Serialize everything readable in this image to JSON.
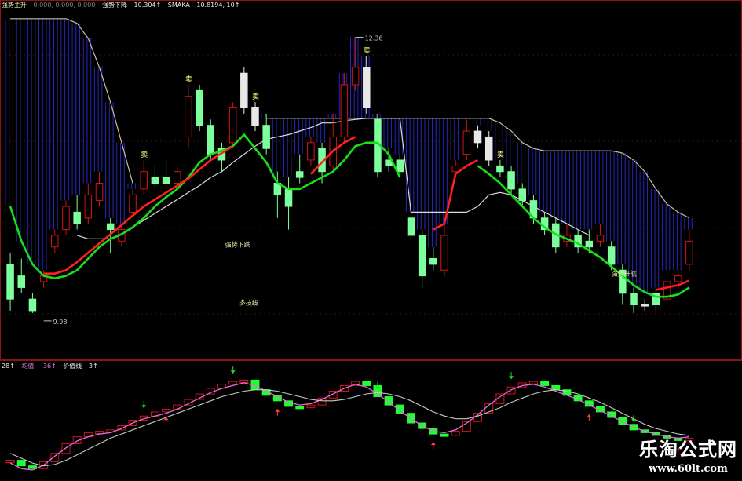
{
  "top_legend": {
    "name1": "强势主升",
    "vals1": "0.000, 0.000, 0.000",
    "name2": "强势下降",
    "val2": "10.304↑",
    "name3": "SMAKA",
    "val3": "10.8194, 10↑"
  },
  "bottom_legend": {
    "v1": "28↑",
    "name2": "均值",
    "val2": "-36↑",
    "name3": "价值线",
    "val3": "3↑"
  },
  "annotations": {
    "high_label": "12.36",
    "low_label": "9.98",
    "sell_text": "卖",
    "line_label_1": "强势下跌",
    "line_label_2": "多技线",
    "line_label_3": "强势开航"
  },
  "watermark": {
    "line1": "乐淘公式网",
    "line2": "www.60lt.com"
  },
  "colors": {
    "up": "#d01515",
    "up_hollow_fill": "#000000",
    "down": "#7dff9d",
    "down_white": "#e8e8e8",
    "green_ma": "#18e018",
    "red_ma": "#ff2020",
    "white_ma": "#dcdcdc",
    "cloud": "#2626b8",
    "panel_border": "#8a1515",
    "grid": "#3a0f0f"
  },
  "chart_data": [
    {
      "type": "candlestick",
      "title": "",
      "ylim": [
        9.6,
        12.6
      ],
      "high": 12.36,
      "low": 9.98,
      "candles": [
        {
          "o": 10.1,
          "c": 10.4,
          "h": 10.5,
          "l": 10.0,
          "d": "down"
        },
        {
          "o": 10.3,
          "c": 10.2,
          "h": 10.45,
          "l": 10.15,
          "d": "down"
        },
        {
          "o": 10.0,
          "c": 10.1,
          "h": 10.15,
          "l": 9.98,
          "d": "down"
        },
        {
          "o": 10.25,
          "c": 10.3,
          "h": 10.35,
          "l": 10.2,
          "d": "up"
        },
        {
          "o": 10.55,
          "c": 10.65,
          "h": 10.7,
          "l": 10.5,
          "d": "up"
        },
        {
          "o": 10.7,
          "c": 10.9,
          "h": 10.95,
          "l": 10.65,
          "d": "up"
        },
        {
          "o": 10.85,
          "c": 10.75,
          "h": 11.0,
          "l": 10.7,
          "d": "down"
        },
        {
          "o": 10.8,
          "c": 11.0,
          "h": 11.1,
          "l": 10.75,
          "d": "up"
        },
        {
          "o": 10.95,
          "c": 11.1,
          "h": 11.2,
          "l": 10.9,
          "d": "up"
        },
        {
          "o": 10.75,
          "c": 10.7,
          "h": 10.8,
          "l": 10.5,
          "d": "down"
        },
        {
          "o": 10.7,
          "c": 10.6,
          "h": 10.75,
          "l": 10.55,
          "d": "up"
        },
        {
          "o": 10.85,
          "c": 11.0,
          "h": 11.05,
          "l": 10.8,
          "d": "up"
        },
        {
          "o": 11.05,
          "c": 11.2,
          "h": 11.3,
          "l": 11.0,
          "d": "up"
        },
        {
          "o": 11.15,
          "c": 11.1,
          "h": 11.25,
          "l": 11.05,
          "d": "down"
        },
        {
          "o": 11.1,
          "c": 11.15,
          "h": 11.3,
          "l": 11.05,
          "d": "down"
        },
        {
          "o": 11.1,
          "c": 11.2,
          "h": 11.25,
          "l": 11.05,
          "d": "up"
        },
        {
          "o": 11.5,
          "c": 11.85,
          "h": 11.95,
          "l": 11.4,
          "d": "up"
        },
        {
          "o": 11.9,
          "c": 11.6,
          "h": 11.95,
          "l": 11.55,
          "d": "down"
        },
        {
          "o": 11.6,
          "c": 11.35,
          "h": 11.65,
          "l": 11.3,
          "d": "down"
        },
        {
          "o": 11.4,
          "c": 11.3,
          "h": 11.45,
          "l": 11.2,
          "d": "down"
        },
        {
          "o": 11.45,
          "c": 11.75,
          "h": 11.8,
          "l": 11.4,
          "d": "up"
        },
        {
          "o": 12.05,
          "c": 11.75,
          "h": 12.1,
          "l": 11.7,
          "d": "down_white"
        },
        {
          "o": 11.75,
          "c": 11.6,
          "h": 11.8,
          "l": 11.55,
          "d": "down_white"
        },
        {
          "o": 11.6,
          "c": 11.4,
          "h": 11.7,
          "l": 11.35,
          "d": "down"
        },
        {
          "o": 11.1,
          "c": 11.0,
          "h": 11.2,
          "l": 10.8,
          "d": "down"
        },
        {
          "o": 11.05,
          "c": 10.9,
          "h": 11.15,
          "l": 10.7,
          "d": "down"
        },
        {
          "o": 11.15,
          "c": 11.2,
          "h": 11.35,
          "l": 11.1,
          "d": "down"
        },
        {
          "o": 11.3,
          "c": 11.45,
          "h": 11.5,
          "l": 11.25,
          "d": "up"
        },
        {
          "o": 11.4,
          "c": 11.2,
          "h": 11.45,
          "l": 11.1,
          "d": "down"
        },
        {
          "o": 11.25,
          "c": 11.5,
          "h": 11.7,
          "l": 11.2,
          "d": "up"
        },
        {
          "o": 11.5,
          "c": 11.95,
          "h": 12.05,
          "l": 11.45,
          "d": "up"
        },
        {
          "o": 11.95,
          "c": 12.1,
          "h": 12.36,
          "l": 11.9,
          "d": "up"
        },
        {
          "o": 12.1,
          "c": 11.75,
          "h": 12.2,
          "l": 11.7,
          "d": "down_white"
        },
        {
          "o": 11.65,
          "c": 11.2,
          "h": 11.7,
          "l": 11.15,
          "d": "down"
        },
        {
          "o": 11.3,
          "c": 11.25,
          "h": 11.4,
          "l": 11.2,
          "d": "down"
        },
        {
          "o": 11.3,
          "c": 11.2,
          "h": 11.35,
          "l": 11.15,
          "d": "down"
        },
        {
          "o": 10.8,
          "c": 10.65,
          "h": 10.85,
          "l": 10.6,
          "d": "down"
        },
        {
          "o": 10.65,
          "c": 10.3,
          "h": 10.7,
          "l": 10.2,
          "d": "down"
        },
        {
          "o": 10.4,
          "c": 10.45,
          "h": 10.55,
          "l": 10.35,
          "d": "down"
        },
        {
          "o": 10.35,
          "c": 10.65,
          "h": 10.75,
          "l": 10.3,
          "d": "up"
        },
        {
          "o": 11.2,
          "c": 11.25,
          "h": 11.3,
          "l": 11.15,
          "d": "up"
        },
        {
          "o": 11.35,
          "c": 11.55,
          "h": 11.65,
          "l": 11.3,
          "d": "up"
        },
        {
          "o": 11.55,
          "c": 11.45,
          "h": 11.6,
          "l": 11.4,
          "d": "down_white"
        },
        {
          "o": 11.5,
          "c": 11.3,
          "h": 11.55,
          "l": 11.25,
          "d": "down_white"
        },
        {
          "o": 11.25,
          "c": 11.2,
          "h": 11.3,
          "l": 11.15,
          "d": "down"
        },
        {
          "o": 11.2,
          "c": 11.05,
          "h": 11.25,
          "l": 11.0,
          "d": "down"
        },
        {
          "o": 11.05,
          "c": 10.95,
          "h": 11.1,
          "l": 10.9,
          "d": "down"
        },
        {
          "o": 10.95,
          "c": 10.8,
          "h": 11.0,
          "l": 10.75,
          "d": "down"
        },
        {
          "o": 10.8,
          "c": 10.7,
          "h": 10.85,
          "l": 10.65,
          "d": "down"
        },
        {
          "o": 10.75,
          "c": 10.55,
          "h": 10.8,
          "l": 10.5,
          "d": "down"
        },
        {
          "o": 10.6,
          "c": 10.65,
          "h": 10.75,
          "l": 10.55,
          "d": "up"
        },
        {
          "o": 10.65,
          "c": 10.55,
          "h": 10.7,
          "l": 10.5,
          "d": "down"
        },
        {
          "o": 10.6,
          "c": 10.55,
          "h": 10.7,
          "l": 10.5,
          "d": "down"
        },
        {
          "o": 10.6,
          "c": 10.65,
          "h": 10.75,
          "l": 10.55,
          "d": "up"
        },
        {
          "o": 10.55,
          "c": 10.4,
          "h": 10.6,
          "l": 10.35,
          "d": "down"
        },
        {
          "o": 10.35,
          "c": 10.15,
          "h": 10.4,
          "l": 10.05,
          "d": "down"
        },
        {
          "o": 10.15,
          "c": 10.05,
          "h": 10.2,
          "l": 9.98,
          "d": "down"
        },
        {
          "o": 10.05,
          "c": 10.05,
          "h": 10.1,
          "l": 10.0,
          "d": "down_white"
        },
        {
          "o": 10.05,
          "c": 10.15,
          "h": 10.2,
          "l": 9.98,
          "d": "down"
        },
        {
          "o": 10.1,
          "c": 10.25,
          "h": 10.35,
          "l": 10.05,
          "d": "up"
        },
        {
          "o": 10.25,
          "c": 10.3,
          "h": 10.35,
          "l": 10.2,
          "d": "up"
        },
        {
          "o": 10.4,
          "c": 10.6,
          "h": 10.7,
          "l": 10.35,
          "d": "up"
        }
      ],
      "series": [
        {
          "key": "green",
          "values": [
            10.9,
            10.6,
            10.4,
            10.3,
            10.28,
            10.3,
            10.35,
            10.45,
            10.55,
            10.62,
            10.66,
            10.72,
            10.8,
            10.9,
            10.98,
            11.05,
            11.15,
            11.28,
            11.35,
            11.38,
            11.42,
            11.52,
            11.4,
            11.28,
            11.1,
            11.05,
            11.05,
            11.1,
            11.15,
            11.2,
            11.3,
            11.42,
            11.45,
            11.45,
            11.35,
            11.15,
            null,
            null,
            null,
            null,
            null,
            null,
            11.25,
            11.18,
            11.1,
            11.0,
            10.9,
            10.8,
            10.72,
            10.66,
            10.62,
            10.58,
            10.52,
            10.46,
            10.38,
            10.3,
            10.22,
            10.16,
            10.12,
            10.12,
            10.14,
            10.2
          ]
        },
        {
          "key": "red",
          "values": [
            null,
            null,
            null,
            10.32,
            10.32,
            10.35,
            10.42,
            10.5,
            10.58,
            10.66,
            10.74,
            10.82,
            10.9,
            10.96,
            11.02,
            11.08,
            11.14,
            11.22,
            11.3,
            11.36,
            11.42,
            null,
            null,
            null,
            null,
            null,
            null,
            11.18,
            11.28,
            11.38,
            11.45,
            11.5,
            null,
            null,
            null,
            null,
            null,
            null,
            10.7,
            10.75,
            11.18,
            11.25,
            11.3,
            null,
            null,
            null,
            null,
            null,
            null,
            null,
            null,
            null,
            null,
            null,
            null,
            null,
            null,
            null,
            10.18,
            10.2,
            10.22,
            10.26
          ]
        },
        {
          "key": "white",
          "values": [
            null,
            null,
            null,
            null,
            null,
            null,
            10.65,
            10.62,
            10.62,
            10.62,
            10.65,
            10.72,
            10.78,
            10.84,
            10.9,
            10.96,
            11.02,
            11.08,
            11.15,
            11.2,
            11.28,
            11.35,
            11.42,
            11.48,
            11.5,
            11.52,
            11.55,
            11.58,
            11.62,
            11.62,
            11.64,
            11.65,
            11.66,
            11.66,
            11.66,
            11.66,
            10.85,
            10.85,
            10.85,
            10.85,
            10.85,
            10.85,
            10.9,
            11.0,
            11.02,
            11.0,
            10.95,
            10.9,
            10.85,
            10.8,
            10.75,
            10.7,
            10.65,
            null,
            null,
            null,
            null,
            null,
            null,
            null,
            null,
            null
          ]
        },
        {
          "key": "cloud",
          "values": [
            12.52,
            12.52,
            12.52,
            12.52,
            12.52,
            12.52,
            12.48,
            12.35,
            12.1,
            11.8,
            11.45,
            11.1,
            null,
            null,
            null,
            null,
            null,
            null,
            null,
            null,
            null,
            null,
            null,
            11.66,
            11.66,
            11.66,
            11.66,
            11.66,
            11.66,
            11.66,
            11.66,
            11.66,
            11.66,
            11.66,
            11.66,
            11.66,
            11.66,
            11.66,
            11.66,
            11.66,
            11.66,
            11.66,
            11.66,
            11.66,
            11.62,
            11.55,
            11.45,
            11.4,
            11.38,
            11.38,
            11.38,
            11.38,
            11.38,
            11.38,
            11.38,
            11.36,
            11.3,
            11.2,
            11.05,
            10.92,
            10.85,
            10.8
          ]
        }
      ],
      "signals": [
        {
          "i": 12,
          "label": "卖"
        },
        {
          "i": 16,
          "label": "卖"
        },
        {
          "i": 22,
          "label": "卖"
        },
        {
          "i": 32,
          "label": "卖"
        },
        {
          "i": 44,
          "label": "卖"
        }
      ]
    },
    {
      "type": "line",
      "title": "",
      "ylim": [
        -80,
        80
      ],
      "series": [
        {
          "name": "均值",
          "values": [
            -62,
            -70,
            -72,
            -65,
            -52,
            -40,
            -30,
            -24,
            -20,
            -18,
            -12,
            -4,
            2,
            6,
            10,
            16,
            24,
            32,
            40,
            46,
            50,
            54,
            50,
            42,
            34,
            26,
            22,
            24,
            30,
            38,
            46,
            52,
            48,
            38,
            26,
            14,
            2,
            -8,
            -16,
            -18,
            -14,
            -4,
            8,
            22,
            34,
            44,
            50,
            52,
            48,
            42,
            36,
            30,
            22,
            14,
            6,
            -2,
            -10,
            -16,
            -20,
            -24,
            -26,
            -24
          ]
        },
        {
          "name": "价值线",
          "values": [
            -48,
            -55,
            -62,
            -66,
            -64,
            -58,
            -50,
            -42,
            -34,
            -26,
            -20,
            -14,
            -8,
            -2,
            4,
            10,
            16,
            22,
            28,
            34,
            38,
            42,
            44,
            44,
            42,
            38,
            34,
            30,
            28,
            28,
            30,
            34,
            38,
            40,
            38,
            34,
            28,
            20,
            12,
            6,
            2,
            2,
            6,
            12,
            18,
            26,
            32,
            38,
            42,
            44,
            42,
            38,
            32,
            26,
            18,
            10,
            2,
            -6,
            -12,
            -16,
            -20,
            -22
          ]
        }
      ],
      "bars": [
        -58,
        -66,
        -70,
        -60,
        -48,
        -34,
        -24,
        -18,
        -16,
        -14,
        -8,
        0,
        6,
        12,
        16,
        22,
        30,
        38,
        46,
        52,
        56,
        58,
        44,
        36,
        28,
        20,
        18,
        22,
        32,
        42,
        50,
        56,
        50,
        34,
        22,
        10,
        -4,
        -12,
        -20,
        -22,
        -16,
        -2,
        10,
        24,
        38,
        48,
        54,
        56,
        50,
        44,
        36,
        28,
        20,
        12,
        4,
        -6,
        -14,
        -18,
        -22,
        -26,
        -28,
        -26
      ],
      "up_arrows": [
        12,
        20,
        33,
        45,
        56
      ],
      "down_arrows": [
        14,
        24,
        38,
        52,
        60
      ]
    }
  ]
}
